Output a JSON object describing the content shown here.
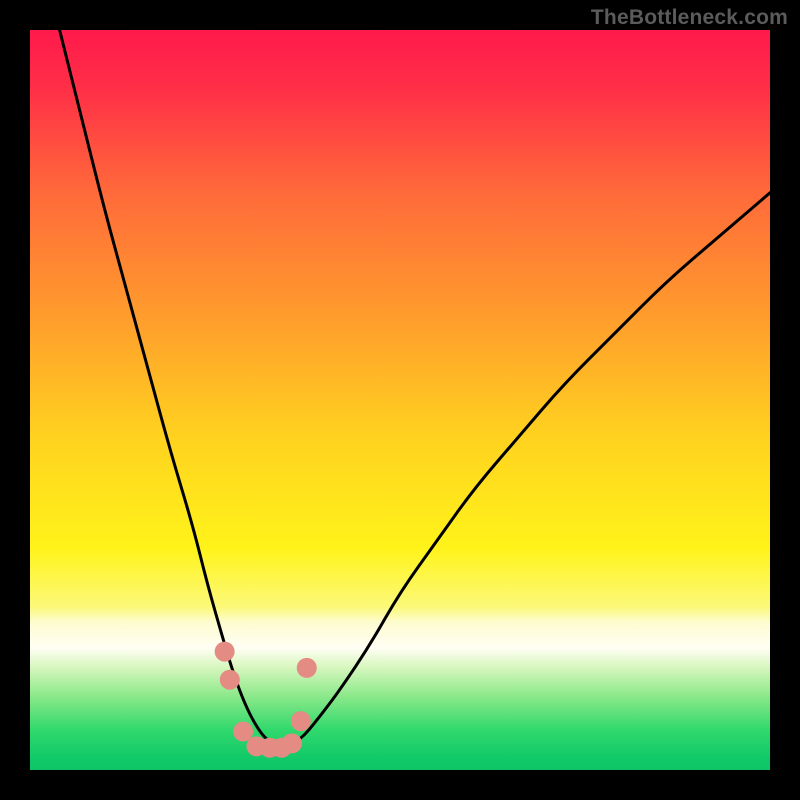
{
  "watermark": "TheBottleneck.com",
  "chart_data": {
    "type": "line",
    "title": "",
    "xlabel": "",
    "ylabel": "",
    "xlim": [
      0,
      100
    ],
    "ylim": [
      0,
      100
    ],
    "grid": false,
    "legend": false,
    "gradient_stops": [
      {
        "offset": 0.0,
        "color": "#ff1a4b"
      },
      {
        "offset": 0.08,
        "color": "#ff2f47"
      },
      {
        "offset": 0.22,
        "color": "#ff6a3a"
      },
      {
        "offset": 0.38,
        "color": "#ff9a2d"
      },
      {
        "offset": 0.55,
        "color": "#ffd21f"
      },
      {
        "offset": 0.7,
        "color": "#fff31a"
      },
      {
        "offset": 0.78,
        "color": "#fcf97a"
      },
      {
        "offset": 0.8,
        "color": "#fdfccf"
      },
      {
        "offset": 0.835,
        "color": "#fffef4"
      },
      {
        "offset": 0.86,
        "color": "#d9f7c0"
      },
      {
        "offset": 0.9,
        "color": "#8ce98a"
      },
      {
        "offset": 0.945,
        "color": "#32d96d"
      },
      {
        "offset": 0.985,
        "color": "#10c968"
      },
      {
        "offset": 1.0,
        "color": "#0fc466"
      }
    ],
    "series": [
      {
        "name": "bottleneck-curve",
        "type": "line",
        "color": "#000000",
        "stroke_width": 3,
        "x": [
          4,
          7,
          10,
          13,
          16,
          19,
          22,
          24,
          26,
          27.5,
          29,
          30.5,
          32,
          34,
          36.5,
          39,
          42,
          46,
          50,
          55,
          60,
          66,
          72,
          79,
          86,
          93,
          100
        ],
        "values": [
          100,
          88,
          76,
          65,
          54,
          43,
          33,
          25,
          18,
          13,
          9,
          6,
          4,
          3,
          4,
          7,
          11,
          17,
          24,
          31,
          38,
          45,
          52,
          59,
          66,
          72,
          78
        ]
      },
      {
        "name": "highlight-markers",
        "type": "scatter",
        "color": "#e48b84",
        "radius": 10,
        "x": [
          26.3,
          27.0,
          28.8,
          30.6,
          32.4,
          34.0,
          35.4,
          36.6,
          37.4
        ],
        "values": [
          16.0,
          12.2,
          5.2,
          3.2,
          3.0,
          3.0,
          3.6,
          6.6,
          13.8
        ]
      }
    ]
  }
}
